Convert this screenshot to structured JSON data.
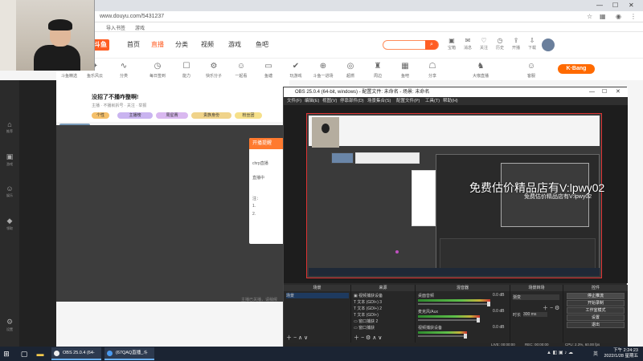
{
  "browser": {
    "url": "www.douyu.com/5431237",
    "bookmarks": [
      "导入书签",
      "游戏"
    ]
  },
  "site": {
    "logo": "斗鱼",
    "nav": [
      "首页",
      "直播",
      "分类",
      "视频",
      "游戏",
      "鱼吧"
    ],
    "active_nav": "直播",
    "top_icons": [
      {
        "icon": "chest-icon",
        "label": "宝箱"
      },
      {
        "icon": "message-icon",
        "label": "消息"
      },
      {
        "icon": "follow-icon",
        "label": "关注"
      },
      {
        "icon": "history-icon",
        "label": "历史"
      },
      {
        "icon": "upload-icon",
        "label": "开播"
      },
      {
        "icon": "download-icon",
        "label": "下载"
      }
    ],
    "categories": [
      "斗鱼精选",
      "鱼乐风云",
      "分类",
      "每日签到",
      "能力",
      "快乐分子",
      "一起看",
      "鱼塘",
      "玩游戏",
      "斗鱼一进场",
      "超燃",
      "周边",
      "鱼吧",
      "分享",
      "大咖直播",
      "客服"
    ],
    "brand_banner": "K·Bang",
    "left_rail": [
      {
        "icon": "home-icon",
        "label": "推荐"
      },
      {
        "icon": "game-icon",
        "label": "游戏"
      },
      {
        "icon": "video-icon",
        "label": "娱乐"
      },
      {
        "icon": "diamond-icon",
        "label": "领取"
      },
      {
        "icon": "settings-icon",
        "label": "设置"
      }
    ]
  },
  "stream": {
    "title": "没招了不播咋整啊!",
    "meta": "主播 · 不播就拆号 · 关注 · 举报",
    "tags": [
      "个性",
      "主播榜",
      "周星赛",
      "贵族身份",
      "粉丝团"
    ],
    "popup_header": "开播提醒",
    "popup_lines": [
      "chrp直播",
      "直播中",
      "注：",
      "1.",
      "2."
    ],
    "player_tip": "主播已关播，请稍候"
  },
  "obs": {
    "title": "OBS 25.0.4 (64-bit, windows) - 配置文件: 未命名 - 场景: 未命名",
    "menu": [
      "文件(F)",
      "编辑(E)",
      "视图(V)",
      "停靠部件(D)",
      "场景集合(S)",
      "配置文件(P)",
      "工具(T)",
      "帮助(H)"
    ],
    "docks": {
      "scenes": {
        "header": "场景",
        "items": [
          "场景"
        ]
      },
      "sources": {
        "header": "来源",
        "items": [
          "视频捕获设备",
          "文本 (GDI+) 3",
          "文本 (GDI+) 2",
          "文本 (GDI+)",
          "窗口捕获 2",
          "窗口捕获"
        ]
      },
      "mixer": {
        "header": "混音器",
        "channels": [
          {
            "name": "桌面音频",
            "db": "0.0 dB",
            "level": 0.82
          },
          {
            "name": "麦克风/Aux",
            "db": "0.0 dB",
            "level": 0.7
          },
          {
            "name": "视频捕获设备",
            "db": "0.0 dB",
            "level": 0.55
          }
        ]
      },
      "transitions": {
        "header": "场景转场",
        "value": "渐变",
        "duration_label": "时长",
        "duration": "300 ms"
      },
      "controls": {
        "header": "控件",
        "buttons": [
          "停止推流",
          "开始录制",
          "工作室模式",
          "设置",
          "退出"
        ]
      }
    },
    "status": {
      "live": "LIVE: 00:00:00",
      "rec": "REC: 00:00:00",
      "cpu": "CPU: 2.3%, 60.00 fps"
    }
  },
  "watermark": {
    "main": "免费估价精品店有V:lpwy02",
    "sub": "免费估价精品店有V:lpwy02"
  },
  "taskbar": {
    "apps": [
      "OBS 25.0.4 (64-bi...",
      "(67QAQ直播_斗(1..."
    ],
    "tray_lang": "英",
    "time": "下午 2:24:23",
    "date": "2022/1/28 星期五"
  }
}
